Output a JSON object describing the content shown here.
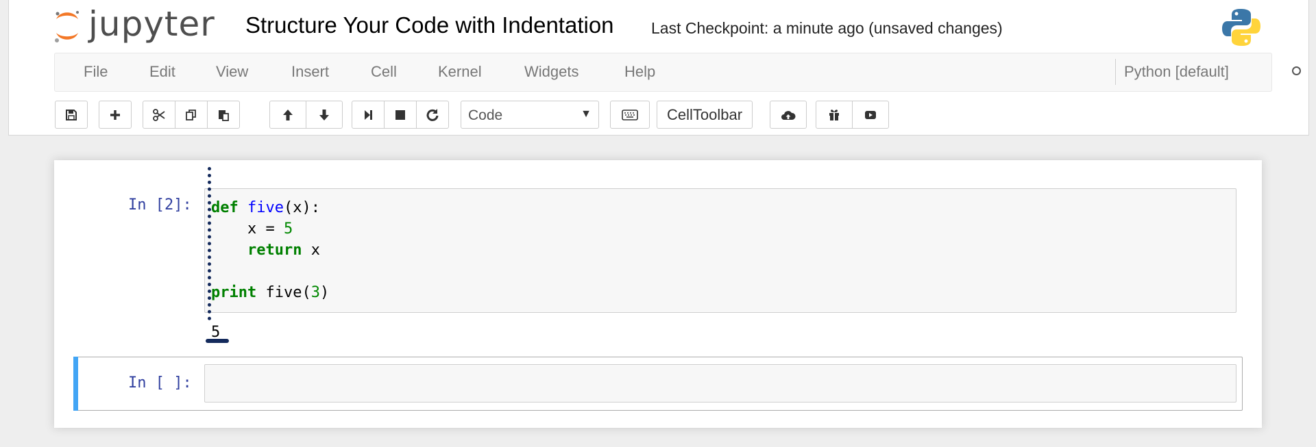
{
  "header": {
    "logo_text": "jupyter",
    "notebook_title": "Structure Your Code with Indentation",
    "checkpoint_status": "Last Checkpoint: a minute ago (unsaved changes)"
  },
  "menu": {
    "items": [
      "File",
      "Edit",
      "View",
      "Insert",
      "Cell",
      "Kernel",
      "Widgets",
      "Help"
    ],
    "kernel_name": "Python [default]"
  },
  "toolbar": {
    "buttons": [
      "save-icon",
      "plus-icon",
      "scissors-icon",
      "copy-icon",
      "paste-icon",
      "arrow-up-icon",
      "arrow-down-icon",
      "step-forward-icon",
      "stop-icon",
      "refresh-icon",
      "keyboard-icon",
      "cloud-upload-icon",
      "gift-icon",
      "youtube-play-icon"
    ],
    "cell_type": "Code",
    "celltoolbar_label": "CellToolbar"
  },
  "cells": [
    {
      "prompt": "In [2]:",
      "code": [
        "def five(x):",
        "    x = 5",
        "    return x",
        "",
        "print five(3)"
      ],
      "output": "5"
    },
    {
      "prompt": "In [ ]:",
      "code": []
    }
  ],
  "colors": {
    "prompt": "#303f9f",
    "keyword": "#008000",
    "function_name": "#0000ff",
    "selected_cell_bar": "#42a5f5",
    "annotation_ink": "#142a5c"
  }
}
